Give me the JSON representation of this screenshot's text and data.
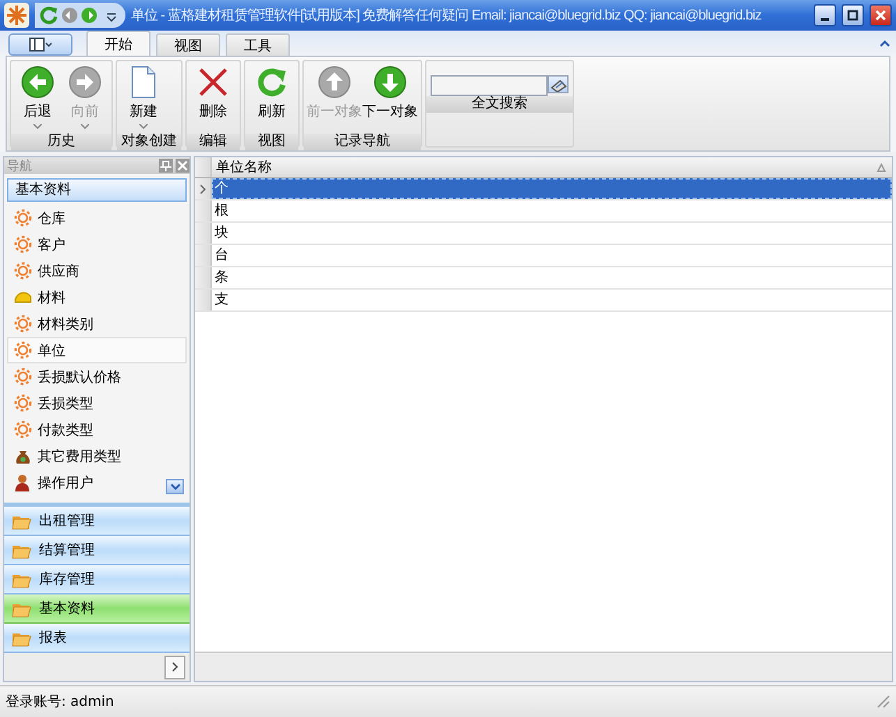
{
  "window": {
    "title": "单位 - 蓝格建材租赁管理软件[试用版本] 免费解答任何疑问 Email: jiancai@bluegrid.biz QQ: jiancai@bluegrid.biz"
  },
  "tabs": [
    {
      "label": "开始",
      "selected": true
    },
    {
      "label": "视图",
      "selected": false
    },
    {
      "label": "工具",
      "selected": false
    }
  ],
  "ribbon": [
    {
      "label": "历史",
      "buttons": [
        {
          "kind": "back",
          "label": "后退",
          "disabled": false,
          "has_menu": true
        },
        {
          "kind": "forward",
          "label": "向前",
          "disabled": true,
          "has_menu": true
        }
      ]
    },
    {
      "label": "对象创建",
      "buttons": [
        {
          "kind": "new",
          "label": "新建",
          "disabled": false,
          "has_menu": true
        }
      ]
    },
    {
      "label": "编辑",
      "buttons": [
        {
          "kind": "delete",
          "label": "删除",
          "disabled": false,
          "has_menu": false
        }
      ]
    },
    {
      "label": "视图",
      "buttons": [
        {
          "kind": "refresh",
          "label": "刷新",
          "disabled": false,
          "has_menu": false
        }
      ]
    },
    {
      "label": "记录导航",
      "buttons": [
        {
          "kind": "up",
          "label": "前一对象",
          "disabled": true,
          "has_menu": false
        },
        {
          "kind": "down",
          "label": "下一对象",
          "disabled": false,
          "has_menu": false
        }
      ]
    },
    {
      "label": "全文搜索",
      "kind": "search"
    }
  ],
  "nav": {
    "title": "导航",
    "section": "基本资料",
    "items": [
      {
        "kind": "gear",
        "label": "仓库",
        "selected": false
      },
      {
        "kind": "gear",
        "label": "客户",
        "selected": false
      },
      {
        "kind": "gear",
        "label": "供应商",
        "selected": false
      },
      {
        "kind": "helmet",
        "label": "材料",
        "selected": false
      },
      {
        "kind": "gear",
        "label": "材料类别",
        "selected": false
      },
      {
        "kind": "gear",
        "label": "单位",
        "selected": true
      },
      {
        "kind": "gear",
        "label": "丢损默认价格",
        "selected": false
      },
      {
        "kind": "gear",
        "label": "丢损类型",
        "selected": false
      },
      {
        "kind": "gear",
        "label": "付款类型",
        "selected": false
      },
      {
        "kind": "bag",
        "label": "其它费用类型",
        "selected": false
      },
      {
        "kind": "user",
        "label": "操作用户",
        "selected": false
      }
    ],
    "groups": [
      {
        "label": "出租管理",
        "selected": false
      },
      {
        "label": "结算管理",
        "selected": false
      },
      {
        "label": "库存管理",
        "selected": false
      },
      {
        "label": "基本资料",
        "selected": true
      },
      {
        "label": "报表",
        "selected": false
      }
    ]
  },
  "table": {
    "columns": [
      "单位名称"
    ],
    "rows": [
      {
        "cells": [
          "个"
        ],
        "selected": true
      },
      {
        "cells": [
          "根"
        ],
        "selected": false
      },
      {
        "cells": [
          "块"
        ],
        "selected": false
      },
      {
        "cells": [
          "台"
        ],
        "selected": false
      },
      {
        "cells": [
          "条"
        ],
        "selected": false
      },
      {
        "cells": [
          "支"
        ],
        "selected": false
      }
    ]
  },
  "status_bar": {
    "text": "登录账号: admin"
  }
}
